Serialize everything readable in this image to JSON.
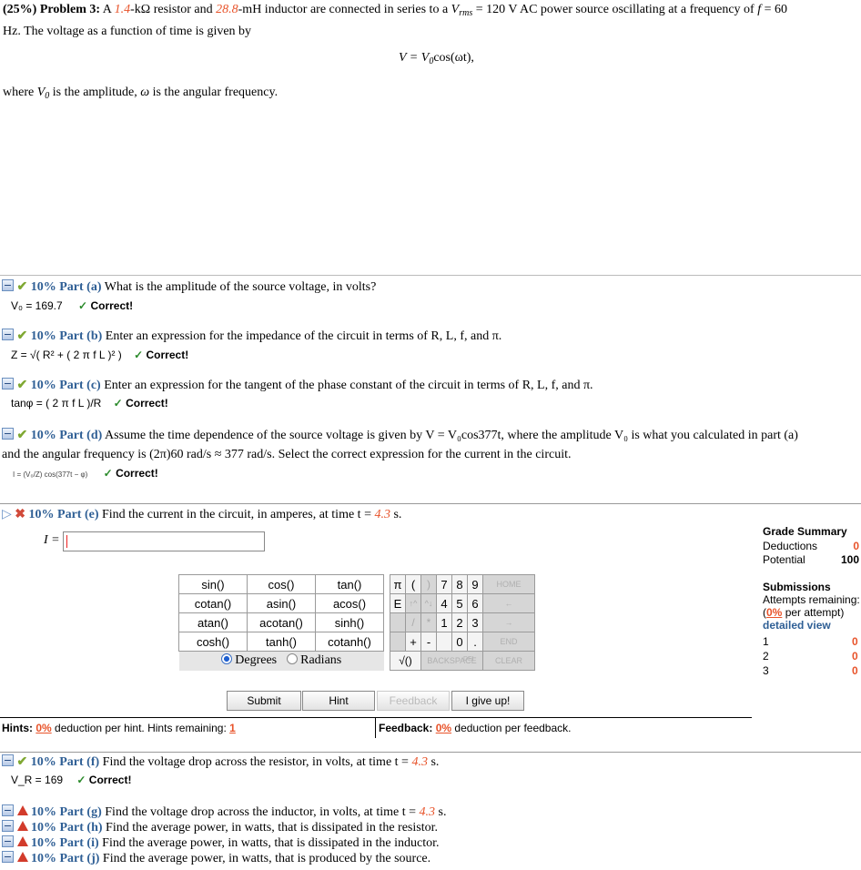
{
  "problem": {
    "header": "(25%) Problem 3:",
    "text_a": "A ",
    "R_value": "1.4",
    "text_b": "-kΩ resistor and ",
    "L_value": "28.8",
    "text_c": "-mH inductor are connected in series to a ",
    "Vrms_sym": "V",
    "Vrms_sub": "rms",
    "text_d": " = 120 V AC power source oscillating at a frequency of ",
    "f_sym": "f",
    "text_e": " = 60",
    "line2": "Hz. The voltage as a function of time is given by",
    "equation": "V = V",
    "equation_sub": "0",
    "equation_tail": "cos(ωt),",
    "where_a": "where ",
    "where_sym": "V",
    "where_sub": "0",
    "where_b": " is the amplitude, ",
    "where_omega": "ω",
    "where_c": " is the angular frequency."
  },
  "parts": {
    "a": {
      "label": "10% Part (a)",
      "question": "What is the amplitude of the source voltage, in volts?",
      "answer": "V₀ = 169.7",
      "status": "Correct!"
    },
    "b": {
      "label": "10% Part (b)",
      "question": "Enter an expression for the impedance of the circuit in terms of R, L, f, and π.",
      "answer": "Z = √( R² + ( 2 π f L )² )",
      "status": "Correct!"
    },
    "c": {
      "label": "10% Part (c)",
      "question": "Enter an expression for the tangent of the phase constant of the circuit in terms of R, L, f, and π.",
      "answer": "tanφ = ( 2 π f L )/R",
      "status": "Correct!"
    },
    "d": {
      "label": "10% Part (d)",
      "question": "Assume the time dependence of the source voltage is given by V = V₀cos377t, where the amplitude V₀ is what you calculated in part (a)",
      "question2": "and the angular frequency is (2π)60 rad/s ≈ 377 rad/s. Select the correct expression for the current in the circuit.",
      "answer": "I = (V₀/Z) cos(377t − φ)",
      "status": "Correct!"
    },
    "e": {
      "label": "10% Part (e)",
      "question": "Find the current in the circuit, in amperes, at time t = ",
      "t_value": "4.3",
      "question_tail": " s.",
      "input_label": "I =",
      "input_value": ""
    },
    "f": {
      "label": "10% Part (f)",
      "question": "Find the voltage drop across the resistor, in volts, at time t = ",
      "t_value": "4.3",
      "question_tail": " s.",
      "answer": "V_R = 169",
      "status": "Correct!"
    },
    "g": {
      "label": "10% Part (g)",
      "question": "Find the voltage drop across the inductor, in volts, at time t = ",
      "t_value": "4.3",
      "question_tail": " s."
    },
    "h": {
      "label": "10% Part (h)",
      "question": "Find the average power, in watts, that is dissipated in the resistor."
    },
    "i": {
      "label": "10% Part (i)",
      "question": "Find the average power, in watts, that is dissipated in the inductor."
    },
    "j": {
      "label": "10% Part (j)",
      "question": "Find the average power, in watts, that is produced by the source."
    }
  },
  "keypad": {
    "functions": [
      [
        "sin()",
        "cos()",
        "tan()"
      ],
      [
        "cotan()",
        "asin()",
        "acos()"
      ],
      [
        "atan()",
        "acotan()",
        "sinh()"
      ],
      [
        "cosh()",
        "tanh()",
        "cotanh()"
      ]
    ],
    "digits": [
      [
        "7",
        "8",
        "9"
      ],
      [
        "4",
        "5",
        "6"
      ],
      [
        "1",
        "2",
        "3"
      ]
    ],
    "zero": "0",
    "dot": ".",
    "pi": "π",
    "open_paren": "(",
    "close_paren": ")",
    "e": "E",
    "up": "↑^",
    "down": "^↓",
    "slash": "/",
    "star": "*",
    "plus": "+",
    "minus": "-",
    "sqrt": "√()",
    "home": "HOME",
    "left": "←",
    "right": "→",
    "end": "END",
    "backspace": "BACKSPACE",
    "del": "DEL",
    "clear": "CLEAR",
    "degrees": "Degrees",
    "radians": "Radians"
  },
  "buttons": {
    "submit": "Submit",
    "hint": "Hint",
    "feedback": "Feedback",
    "give_up": "I give up!"
  },
  "hints": {
    "label": "Hints:",
    "pct": "0%",
    "text": "deduction per hint. Hints remaining:",
    "remaining": "1"
  },
  "feedback": {
    "label": "Feedback:",
    "pct": "0%",
    "text": "deduction per feedback."
  },
  "grade_summary": {
    "title": "Grade Summary",
    "deductions_label": "Deductions",
    "deductions_value": "0",
    "potential_label": "Potential",
    "potential_value": "100",
    "submissions_title": "Submissions",
    "attempts": "Attempts remaining:",
    "per_attempt_pct": "0%",
    "per_attempt": "per attempt)",
    "detailed": "detailed view",
    "rows": [
      {
        "n": "1",
        "v": "0"
      },
      {
        "n": "2",
        "v": "0"
      },
      {
        "n": "3",
        "v": "0"
      }
    ]
  }
}
